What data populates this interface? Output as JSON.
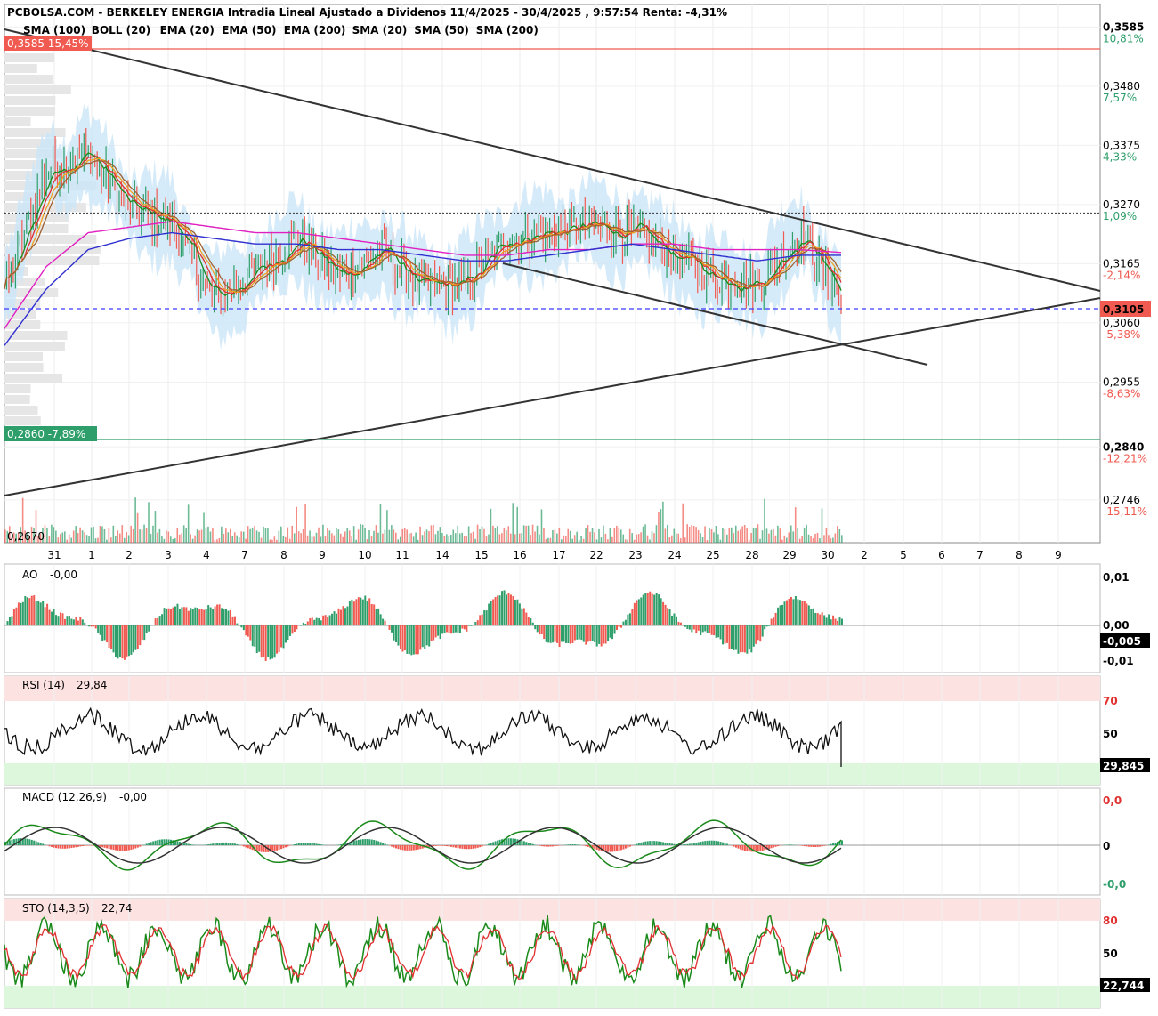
{
  "header": {
    "title": "PCBOLSA.COM - BERKELEY ENERGIA Intradia Lineal Ajustado a Dividenos 11/4/2025 - 30/4/2025 , 9:57:54 Renta: -4,31%"
  },
  "legend": [
    {
      "label": "SMA (100)",
      "color": "#8fcdf0"
    },
    {
      "label": "BOLL (20)",
      "color": "#bdbdbd"
    },
    {
      "label": "EMA (20)",
      "color": "#1a8a1a"
    },
    {
      "label": "EMA (50)",
      "color": "#e03030"
    },
    {
      "label": "EMA (200)",
      "color": "#3030d0"
    },
    {
      "label": "SMA (20)",
      "color": "#f0a020"
    },
    {
      "label": "SMA (50)",
      "color": "#a06030"
    },
    {
      "label": "SMA (200)",
      "color": "#e020c0"
    }
  ],
  "colors": {
    "up": "#2e9e6a",
    "down": "#f05a50",
    "price_line": "#f08080",
    "trend": "#333333",
    "current_price": "#3a3aff",
    "bands": "#cce6f7"
  },
  "price_panel": {
    "high_label": "0,3585  15,45%",
    "low_label": "0,2860  -7,89%",
    "min_label": "0,2670",
    "current_label": "0,3105",
    "reference_price": 0.3255,
    "ticks": [
      {
        "price": "0,3585",
        "pct": "10,81%",
        "pct_color": "#2e9e6a",
        "bold": true,
        "value": 0.3585
      },
      {
        "price": "0,3480",
        "pct": "7,57%",
        "pct_color": "#2e9e6a",
        "bold": false,
        "value": 0.348
      },
      {
        "price": "0,3375",
        "pct": "4,33%",
        "pct_color": "#2e9e6a",
        "bold": false,
        "value": 0.3375
      },
      {
        "price": "0,3270",
        "pct": "1,09%",
        "pct_color": "#2e9e6a",
        "bold": false,
        "value": 0.327
      },
      {
        "price": "0,3165",
        "pct": "-2,14%",
        "pct_color": "#f05a50",
        "bold": false,
        "value": 0.3165
      },
      {
        "price": "0,3060",
        "pct": "-5,38%",
        "pct_color": "#f05a50",
        "bold": false,
        "value": 0.306
      },
      {
        "price": "0,2955",
        "pct": "-8,63%",
        "pct_color": "#f05a50",
        "bold": false,
        "value": 0.2955
      },
      {
        "price": "0,2840",
        "pct": "-12,21%",
        "pct_color": "#f05a50",
        "bold": true,
        "value": 0.284
      },
      {
        "price": "0,2746",
        "pct": "-15,11%",
        "pct_color": "#f05a50",
        "bold": false,
        "value": 0.2746
      }
    ],
    "x_labels": [
      "31",
      "1",
      "2",
      "3",
      "4",
      "7",
      "8",
      "9",
      "10",
      "11",
      "14",
      "15",
      "16",
      "17",
      "22",
      "23",
      "24",
      "25",
      "28",
      "29",
      "30",
      "2",
      "5",
      "6",
      "7",
      "8",
      "9"
    ]
  },
  "ao": {
    "label": "AO",
    "value": "-0,00",
    "ticks": [
      "0,01",
      "0,00",
      "-0,01"
    ],
    "current": "-0,005"
  },
  "rsi": {
    "label": "RSI (14)",
    "value": "29,84",
    "ticks": [
      "70",
      "50"
    ],
    "current": "29,845"
  },
  "macd": {
    "label": "MACD (12,26,9)",
    "value": "-0,00",
    "ticks": [
      "0,0",
      "0",
      "-0,0"
    ],
    "current": ""
  },
  "sto": {
    "label": "STO (14,3,5)",
    "value": "22,74",
    "ticks": [
      "80",
      "50"
    ],
    "current": "22,744"
  },
  "chart_data": {
    "type": "line",
    "title": "PCBOLSA.COM - BERKELEY ENERGIA Intradia Lineal Ajustado a Dividenos 11/4/2025 - 30/4/2025 , 9:57:54 Renta: -4,31%",
    "x": [
      "31",
      "1",
      "2",
      "3",
      "4",
      "7",
      "8",
      "9",
      "10",
      "11",
      "14",
      "15",
      "16",
      "17",
      "22",
      "23",
      "24",
      "25",
      "28",
      "29",
      "30"
    ],
    "ylim": [
      0.267,
      0.3625
    ],
    "series": [
      {
        "name": "",
        "values": [
          0.312,
          0.333,
          0.336,
          0.326,
          0.324,
          0.31,
          0.315,
          0.321,
          0.314,
          0.319,
          0.312,
          0.313,
          0.321,
          0.322,
          0.323,
          0.322,
          0.318,
          0.314,
          0.313,
          0.322,
          0.3105
        ]
      },
      {
        "name": "SMA (200)",
        "values": [
          0.305,
          0.316,
          0.322,
          0.323,
          0.324,
          0.323,
          0.322,
          0.322,
          0.321,
          0.32,
          0.319,
          0.318,
          0.318,
          0.319,
          0.319,
          0.32,
          0.32,
          0.319,
          0.319,
          0.319,
          0.3185
        ]
      },
      {
        "name": "EMA (200)",
        "values": [
          0.302,
          0.312,
          0.319,
          0.321,
          0.322,
          0.321,
          0.32,
          0.32,
          0.319,
          0.319,
          0.318,
          0.317,
          0.317,
          0.318,
          0.319,
          0.32,
          0.319,
          0.318,
          0.317,
          0.318,
          0.318
        ]
      }
    ]
  }
}
